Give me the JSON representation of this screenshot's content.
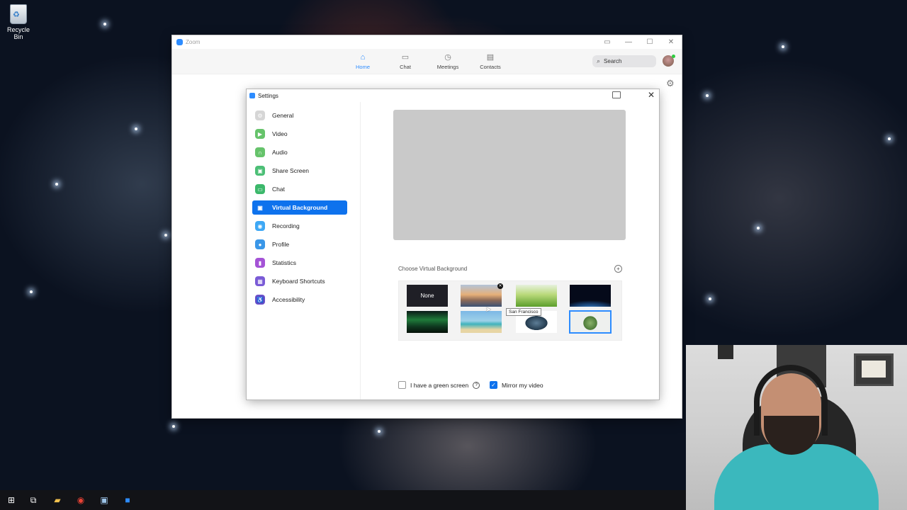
{
  "desktop": {
    "recycle_bin_label": "Recycle Bin"
  },
  "zoom_window": {
    "title": "Zoom",
    "nav": [
      {
        "label": "Home",
        "icon": "home-icon",
        "active": true
      },
      {
        "label": "Chat",
        "icon": "chat-bubble-icon",
        "active": false
      },
      {
        "label": "Meetings",
        "icon": "clock-icon",
        "active": false
      },
      {
        "label": "Contacts",
        "icon": "contacts-icon",
        "active": false
      }
    ],
    "search_placeholder": "Search"
  },
  "settings": {
    "title": "Settings",
    "sidebar": [
      {
        "label": "General",
        "icon": "gear-icon",
        "color": "#d6d6d6"
      },
      {
        "label": "Video",
        "icon": "video-camera-icon",
        "color": "#66c36b"
      },
      {
        "label": "Audio",
        "icon": "headphones-icon",
        "color": "#66c36b"
      },
      {
        "label": "Share Screen",
        "icon": "share-screen-icon",
        "color": "#4cbf76"
      },
      {
        "label": "Chat",
        "icon": "chat-icon",
        "color": "#3cb86b"
      },
      {
        "label": "Virtual Background",
        "icon": "person-icon",
        "color": "#0e72ed",
        "active": true
      },
      {
        "label": "Recording",
        "icon": "record-icon",
        "color": "#3ea8f5"
      },
      {
        "label": "Profile",
        "icon": "profile-icon",
        "color": "#3a97e8"
      },
      {
        "label": "Statistics",
        "icon": "bar-chart-icon",
        "color": "#a453d6"
      },
      {
        "label": "Keyboard Shortcuts",
        "icon": "keyboard-icon",
        "color": "#7a5bd6"
      },
      {
        "label": "Accessibility",
        "icon": "accessibility-icon",
        "color": "#6a4fc9"
      }
    ],
    "choose_label": "Choose Virtual Background",
    "none_label": "None",
    "tooltip": "San Francisco",
    "green_screen_label": "I have a green screen",
    "green_screen_checked": false,
    "mirror_label": "Mirror my video",
    "mirror_checked": true
  },
  "colors": {
    "accent": "#0e72ed",
    "zoom_blue": "#2d8cff"
  }
}
